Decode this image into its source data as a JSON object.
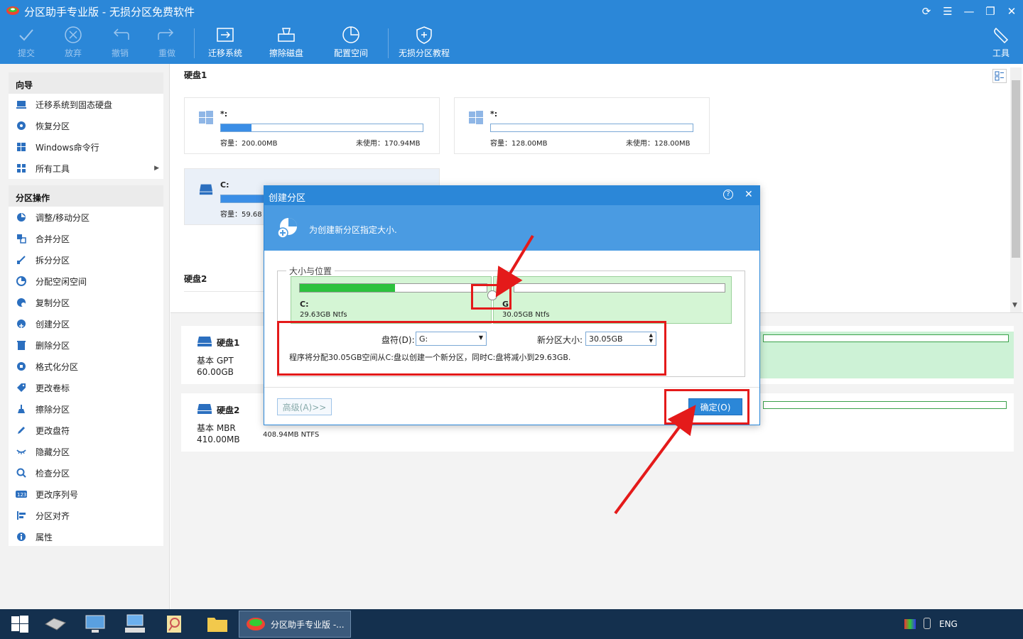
{
  "app": {
    "title": "分区助手专业版 - 无损分区免费软件"
  },
  "toolbar": {
    "commit": "提交",
    "discard": "放弃",
    "undo": "撤销",
    "redo": "重做",
    "migrate": "迁移系统",
    "wipe": "擦除磁盘",
    "allocate": "配置空间",
    "tutorial": "无损分区教程",
    "tools": "工具"
  },
  "sidebar": {
    "wizard_header": "向导",
    "wizard_items": [
      {
        "label": "迁移系统到固态硬盘"
      },
      {
        "label": "恢复分区"
      },
      {
        "label": "Windows命令行"
      },
      {
        "label": "所有工具"
      }
    ],
    "ops_header": "分区操作",
    "ops_items": [
      {
        "label": "调整/移动分区"
      },
      {
        "label": "合并分区"
      },
      {
        "label": "拆分分区"
      },
      {
        "label": "分配空闲空间"
      },
      {
        "label": "复制分区"
      },
      {
        "label": "创建分区"
      },
      {
        "label": "删除分区"
      },
      {
        "label": "格式化分区"
      },
      {
        "label": "更改卷标"
      },
      {
        "label": "擦除分区"
      },
      {
        "label": "更改盘符"
      },
      {
        "label": "隐藏分区"
      },
      {
        "label": "检查分区"
      },
      {
        "label": "更改序列号"
      },
      {
        "label": "分区对齐"
      },
      {
        "label": "属性"
      }
    ]
  },
  "disk1": {
    "label": "硬盘1",
    "cards": [
      {
        "name": "*:",
        "capacity": "容量：200.00MB",
        "unused": "未使用：170.94MB",
        "fill": 0.15
      },
      {
        "name": "*:",
        "capacity": "容量：128.00MB",
        "unused": "未使用：128.00MB",
        "fill": 0
      },
      {
        "name": "C:",
        "capacity": "容量：59.68",
        "fill": 0.5
      }
    ]
  },
  "disk2": {
    "label": "硬盘2"
  },
  "disk_rows": [
    {
      "name": "硬盘1",
      "type": "基本 GPT",
      "size": "60.00GB"
    },
    {
      "name": "硬盘2",
      "type": "基本 MBR",
      "size": "410.00MB",
      "detail": "408.94MB NTFS"
    }
  ],
  "dialog": {
    "title": "创建分区",
    "banner": "为创建新分区指定大小.",
    "group_label": "大小与位置",
    "left_part": {
      "name": "C:",
      "size": "29.63GB Ntfs",
      "fill": 0.51
    },
    "right_part": {
      "name": "G:",
      "size": "30.05GB Ntfs",
      "fill": 0
    },
    "drive_label": "盘符(D):",
    "drive_value": "G:",
    "size_label": "新分区大小:",
    "size_value": "30.05GB",
    "info": "程序将分配30.05GB空间从C:盘以创建一个新分区，同时C:盘将减小到29.63GB.",
    "advanced": "高级(A)>>",
    "ok": "确定(O)"
  },
  "taskbar": {
    "active": "分区助手专业版 -...",
    "lang": "ENG"
  },
  "colors": {
    "accent": "#2b87d8",
    "green": "#2cc23d",
    "annotation": "#e41a1a"
  }
}
